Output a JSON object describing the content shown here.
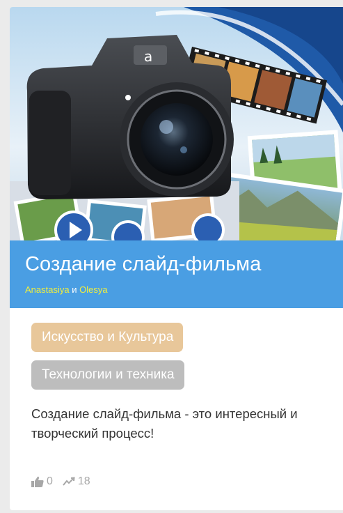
{
  "card": {
    "title": "Создание слайд-фильма",
    "authors": {
      "first": "Anastasiya",
      "conjunction": " и ",
      "second": "Olesya"
    },
    "tags": [
      {
        "label": "Искусство и Культура",
        "color": "#e8c79a"
      },
      {
        "label": "Технологии и техника",
        "color": "#bdbdbd"
      }
    ],
    "description": "Создание слайд-фильма - это интересный и творческий процесс!",
    "stats": {
      "likes": {
        "icon": "thumbs-up-icon",
        "value": "0"
      },
      "views": {
        "icon": "trend-line-icon",
        "value": "18"
      }
    }
  },
  "colors": {
    "title_band": "#4a9ee3",
    "author_link": "#f2ef3b"
  }
}
